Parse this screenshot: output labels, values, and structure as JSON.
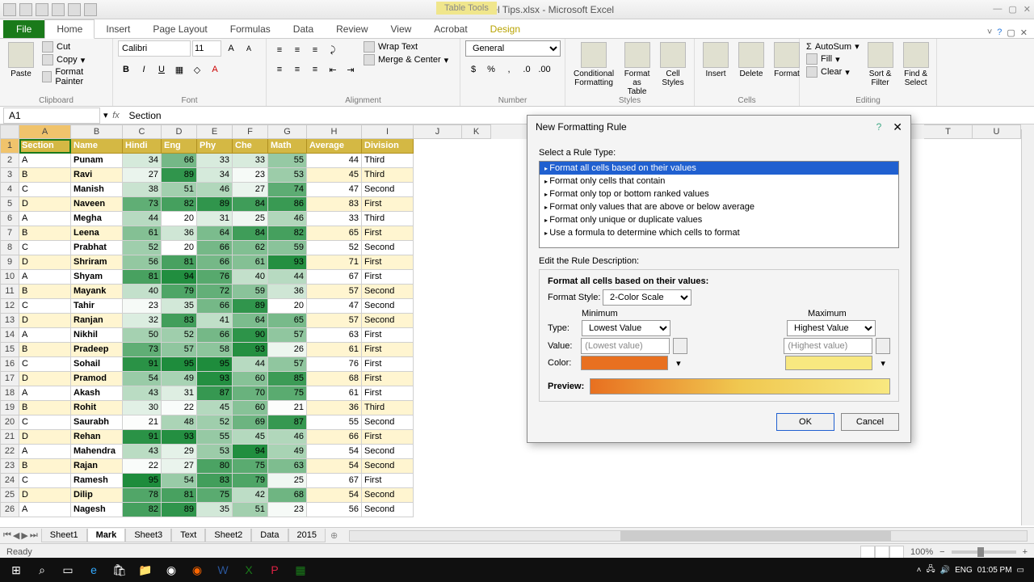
{
  "title": "Excel Tips.xlsx - Microsoft Excel",
  "table_tools": "Table Tools",
  "tabs": {
    "file": "File",
    "home": "Home",
    "insert": "Insert",
    "page_layout": "Page Layout",
    "formulas": "Formulas",
    "data": "Data",
    "review": "Review",
    "view": "View",
    "acrobat": "Acrobat",
    "design": "Design"
  },
  "ribbon": {
    "clipboard": {
      "paste": "Paste",
      "cut": "Cut",
      "copy": "Copy",
      "fp": "Format Painter",
      "label": "Clipboard"
    },
    "font": {
      "name": "Calibri",
      "size": "11",
      "label": "Font"
    },
    "alignment": {
      "wrap": "Wrap Text",
      "merge": "Merge & Center",
      "label": "Alignment"
    },
    "number": {
      "format": "General",
      "label": "Number"
    },
    "styles": {
      "cf": "Conditional\nFormatting",
      "fat": "Format\nas Table",
      "cs": "Cell\nStyles",
      "label": "Styles"
    },
    "cells": {
      "insert": "Insert",
      "delete": "Delete",
      "format": "Format",
      "label": "Cells"
    },
    "editing": {
      "autosum": "AutoSum",
      "fill": "Fill",
      "clear": "Clear",
      "sort": "Sort &\nFilter",
      "find": "Find &\nSelect",
      "label": "Editing"
    }
  },
  "name_box": "A1",
  "formula": "Section",
  "columns": [
    "A",
    "B",
    "C",
    "D",
    "E",
    "F",
    "G",
    "H",
    "I",
    "J",
    "K"
  ],
  "col_after": [
    "T",
    "U"
  ],
  "headers": [
    "Section",
    "Name",
    "Hindi",
    "Eng",
    "Phy",
    "Che",
    "Math",
    "Average",
    "Division"
  ],
  "rows": [
    [
      "A",
      "Punam",
      34,
      66,
      33,
      33,
      55,
      44,
      "Third"
    ],
    [
      "B",
      "Ravi",
      27,
      89,
      34,
      23,
      53,
      45,
      "Third"
    ],
    [
      "C",
      "Manish",
      38,
      51,
      46,
      27,
      74,
      47,
      "Second"
    ],
    [
      "D",
      "Naveen",
      73,
      82,
      89,
      84,
      86,
      83,
      "First"
    ],
    [
      "A",
      "Megha",
      44,
      20,
      31,
      25,
      46,
      33,
      "Third"
    ],
    [
      "B",
      "Leena",
      61,
      36,
      64,
      84,
      82,
      65,
      "First"
    ],
    [
      "C",
      "Prabhat",
      52,
      20,
      66,
      62,
      59,
      52,
      "Second"
    ],
    [
      "D",
      "Shriram",
      56,
      81,
      66,
      61,
      93,
      71,
      "First"
    ],
    [
      "A",
      "Shyam",
      81,
      94,
      76,
      40,
      44,
      67,
      "First"
    ],
    [
      "B",
      "Mayank",
      40,
      79,
      72,
      59,
      36,
      57,
      "Second"
    ],
    [
      "C",
      "Tahir",
      23,
      35,
      66,
      89,
      20,
      47,
      "Second"
    ],
    [
      "D",
      "Ranjan",
      32,
      83,
      41,
      64,
      65,
      57,
      "Second"
    ],
    [
      "A",
      "Nikhil",
      50,
      52,
      66,
      90,
      57,
      63,
      "First"
    ],
    [
      "B",
      "Pradeep",
      73,
      57,
      58,
      93,
      26,
      61,
      "First"
    ],
    [
      "C",
      "Sohail",
      91,
      95,
      95,
      44,
      57,
      76,
      "First"
    ],
    [
      "D",
      "Pramod",
      54,
      49,
      93,
      60,
      85,
      68,
      "First"
    ],
    [
      "A",
      "Akash",
      43,
      31,
      87,
      70,
      75,
      61,
      "First"
    ],
    [
      "B",
      "Rohit",
      30,
      22,
      45,
      60,
      21,
      36,
      "Third"
    ],
    [
      "C",
      "Saurabh",
      21,
      48,
      52,
      69,
      87,
      55,
      "Second"
    ],
    [
      "D",
      "Rehan",
      91,
      93,
      55,
      45,
      46,
      66,
      "First"
    ],
    [
      "A",
      "Mahendra",
      43,
      29,
      53,
      94,
      49,
      54,
      "Second"
    ],
    [
      "B",
      "Rajan",
      22,
      27,
      80,
      75,
      63,
      54,
      "Second"
    ],
    [
      "C",
      "Ramesh",
      95,
      54,
      83,
      79,
      25,
      67,
      "First"
    ],
    [
      "D",
      "Dilip",
      78,
      81,
      75,
      42,
      68,
      54,
      "Second"
    ],
    [
      "A",
      "Nagesh",
      82,
      89,
      35,
      51,
      23,
      56,
      "Second"
    ]
  ],
  "sheet_tabs": [
    "Sheet1",
    "Mark",
    "Sheet3",
    "Text",
    "Sheet2",
    "Data",
    "2015"
  ],
  "active_sheet": "Mark",
  "status": "Ready",
  "zoom": "100%",
  "dialog": {
    "title": "New Formatting Rule",
    "select_label": "Select a Rule Type:",
    "rules": [
      "Format all cells based on their values",
      "Format only cells that contain",
      "Format only top or bottom ranked values",
      "Format only values that are above or below average",
      "Format only unique or duplicate values",
      "Use a formula to determine which cells to format"
    ],
    "edit_label": "Edit the Rule Description:",
    "desc_title": "Format all cells based on their values:",
    "format_style_label": "Format Style:",
    "format_style": "2-Color Scale",
    "min_label": "Minimum",
    "max_label": "Maximum",
    "type_label": "Type:",
    "value_label": "Value:",
    "color_label": "Color:",
    "min_type": "Lowest Value",
    "max_type": "Highest Value",
    "min_value": "(Lowest value)",
    "max_value": "(Highest value)",
    "min_color": "#e87020",
    "max_color": "#f8e880",
    "preview_label": "Preview:",
    "ok": "OK",
    "cancel": "Cancel"
  },
  "taskbar": {
    "lang": "ENG",
    "time": "01:05 PM"
  }
}
